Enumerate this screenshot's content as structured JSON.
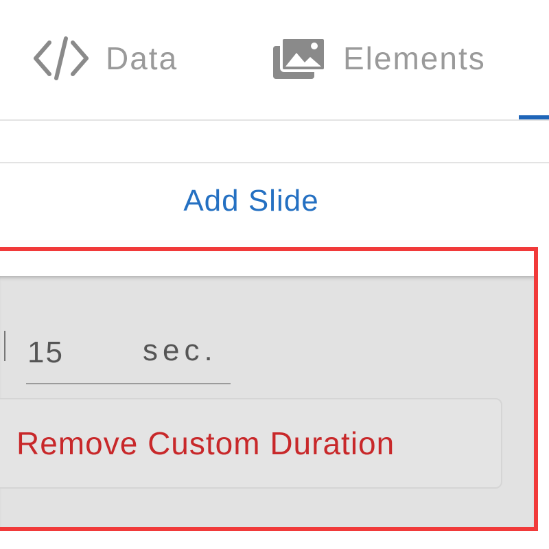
{
  "tabs": [
    {
      "label": "Data",
      "icon": "code-icon"
    },
    {
      "label": "Elements",
      "icon": "images-icon"
    }
  ],
  "add_slide": {
    "label": "Add Slide"
  },
  "slide_duration": {
    "value": "15",
    "unit": "sec.",
    "remove_label": "Remove Custom Duration"
  },
  "colors": {
    "accent": "#2470c2",
    "active_tab_indicator": "#1f65b8",
    "danger": "#c8282a",
    "highlight": "#f13a3a",
    "panel_bg": "#e2e2e2",
    "tab_text": "#9a9a9a"
  }
}
